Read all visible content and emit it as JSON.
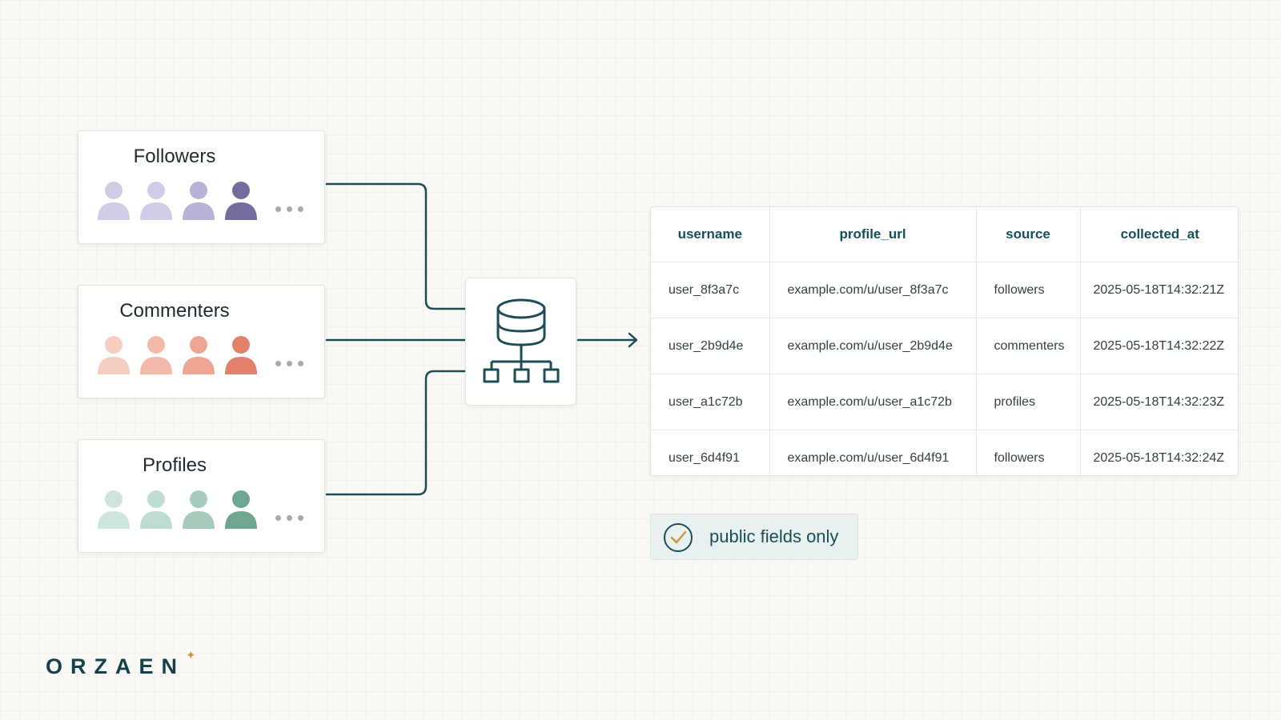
{
  "sources": [
    {
      "title": "Followers",
      "colors": [
        "#cfcde5",
        "#cfcde5",
        "#b7b2d6",
        "#746c9f"
      ]
    },
    {
      "title": "Commenters",
      "colors": [
        "#f6cdc1",
        "#f3b9a9",
        "#eea594",
        "#e2806b"
      ]
    },
    {
      "title": "Profiles",
      "colors": [
        "#cfe5db",
        "#bfdcd0",
        "#a6cbbb",
        "#6fa690"
      ]
    }
  ],
  "hub": {
    "icon": "database-hierarchy-icon"
  },
  "table": {
    "columns": [
      "username",
      "profile_url",
      "source",
      "collected_at"
    ],
    "rows": [
      [
        "user_8f3a7c",
        "example.com/u/user_8f3a7c",
        "followers",
        "2025-05-18T14:32:21Z"
      ],
      [
        "user_2b9d4e",
        "example.com/u/user_2b9d4e",
        "commenters",
        "2025-05-18T14:32:22Z"
      ],
      [
        "user_a1c72b",
        "example.com/u/user_a1c72b",
        "profiles",
        "2025-05-18T14:32:23Z"
      ],
      [
        "user_6d4f91",
        "example.com/u/user_6d4f91",
        "followers",
        "2025-05-18T14:32:24Z"
      ]
    ]
  },
  "badge": {
    "text": "public fields only",
    "icon": "check-circle-icon"
  },
  "brand": {
    "name": "ORZAEN",
    "mark": "✦"
  },
  "colors": {
    "line": "#1c4d56",
    "accent": "#c99a47"
  }
}
